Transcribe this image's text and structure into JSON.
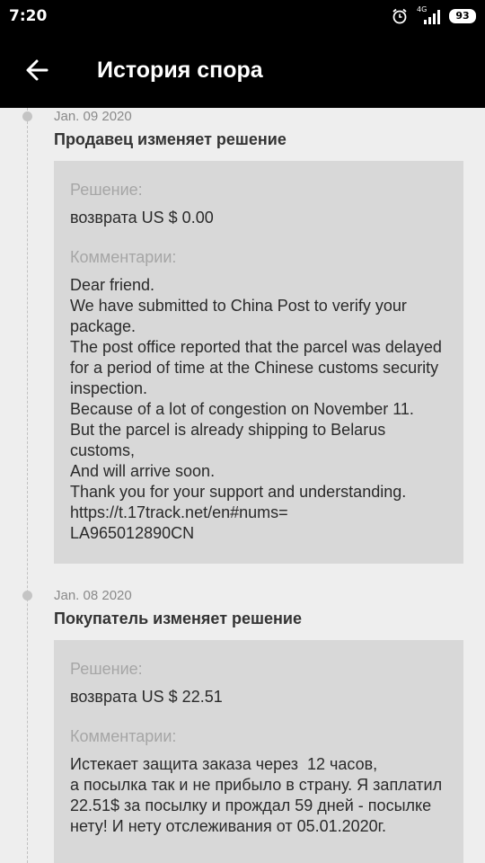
{
  "status_bar": {
    "time": "7:20",
    "network": "4G",
    "battery": "93"
  },
  "header": {
    "title": "История спора"
  },
  "timeline": [
    {
      "date": "Jan. 09 2020",
      "title": "Продавец изменяет решение",
      "solution_label": "Решение:",
      "solution_value": "возврата US $ 0.00",
      "comments_label": "Комментарии:",
      "comment": "Dear friend.\nWe have submitted to China Post to verify your package.\nThe post office reported that the parcel was delayed for a period of time at the Chinese customs security inspection.\nBecause of a lot of congestion on November 11.\nBut the parcel is already shipping to Belarus customs,\nAnd will arrive soon.\nThank you for your support and understanding.\nhttps://t.17track.net/en#nums=\nLA965012890CN"
    },
    {
      "date": "Jan. 08 2020",
      "title": "Покупатель изменяет решение",
      "solution_label": "Решение:",
      "solution_value": "возврата US $ 22.51",
      "comments_label": "Комментарии:",
      "comment": "Истекает защита заказа через  12 часов,\nа посылка так и не прибыло в страну. Я заплатил 22.51$ за посылку и прождал 59 дней - посылке нету! И нету отслеживания от 05.01.2020г."
    }
  ]
}
